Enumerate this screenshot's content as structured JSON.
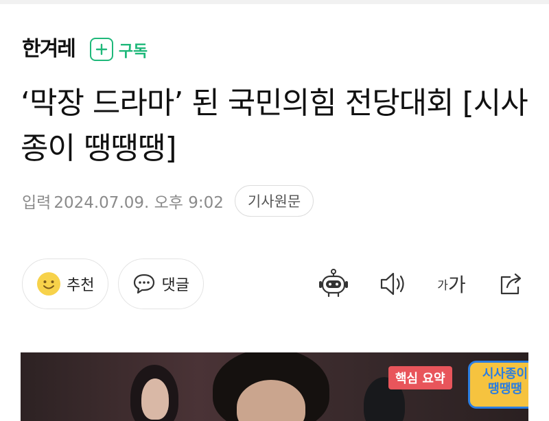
{
  "brand": {
    "logo": "한겨레",
    "subscribe_label": "구독"
  },
  "article": {
    "headline": "‘막장 드라마’ 된 국민의힘 전당대회 [시사종이 땡땡땡]",
    "meta_label": "입력",
    "date": "2024.07.09. 오후 9:02",
    "original_button": "기사원문"
  },
  "actions": {
    "recommend_label": "추천",
    "comment_label": "댓글"
  },
  "tools": {
    "font_small": "가",
    "font_large": "가"
  },
  "hero": {
    "tag": "핵심 요약",
    "badge_line1": "시사종이",
    "badge_line2": "땡땡땡"
  },
  "colors": {
    "accent": "#1fb87a"
  }
}
